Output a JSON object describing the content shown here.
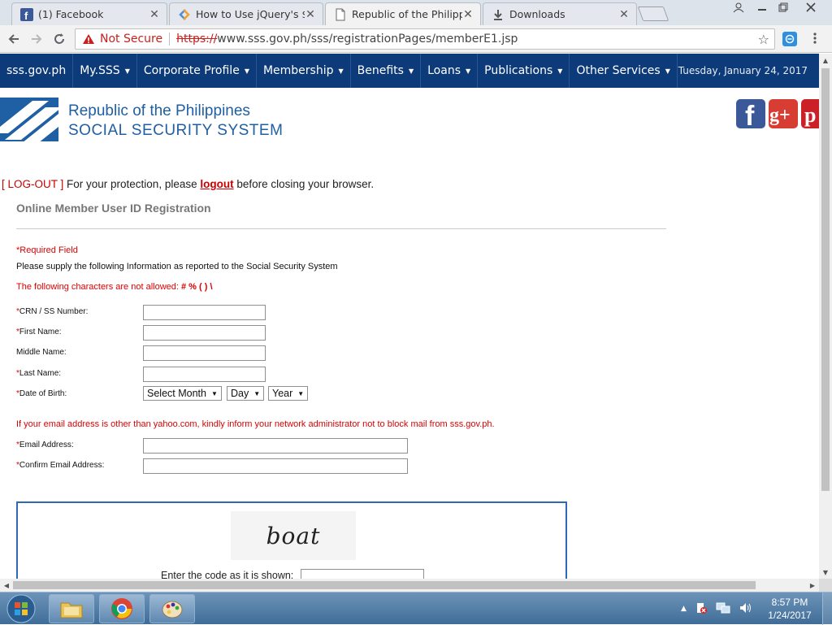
{
  "browser": {
    "tabs": [
      {
        "title": "(1) Facebook",
        "icon": "facebook-icon",
        "active": false
      },
      {
        "title": "How to Use jQuery's $.aj",
        "icon": "code-icon",
        "active": false
      },
      {
        "title": "Republic of the Philippin",
        "icon": "page-icon",
        "active": true
      },
      {
        "title": "Downloads",
        "icon": "download-icon",
        "active": false
      }
    ],
    "close_glyph": "✕",
    "security_label": "Not Secure",
    "url_scheme": "https://",
    "url_rest": "www.sss.gov.ph/sss/registrationPages/memberE1.jsp"
  },
  "sitenav": {
    "items": [
      {
        "label": "sss.gov.ph",
        "caret": false
      },
      {
        "label": "My.SSS",
        "caret": true
      },
      {
        "label": "Corporate Profile",
        "caret": true
      },
      {
        "label": "Membership",
        "caret": true
      },
      {
        "label": "Benefits",
        "caret": true
      },
      {
        "label": "Loans",
        "caret": true
      },
      {
        "label": "Publications",
        "caret": true
      },
      {
        "label": "Other Services",
        "caret": true
      }
    ],
    "date": "Tuesday, January 24, 2017"
  },
  "header": {
    "line1": "Republic of the Philippines",
    "line2": "SOCIAL SECURITY SYSTEM"
  },
  "notice": {
    "logout_tag": "[ LOG-OUT ]",
    "prefix": " For your protection, please ",
    "link": "logout",
    "suffix": " before closing your browser."
  },
  "form": {
    "title": "Online Member User ID Registration",
    "required_note": "*Required Field",
    "supply_note": "Please supply the following Information as reported to the Social Security System",
    "chars_note": "The following characters are not allowed: ",
    "chars_list": "# % ( ) \\",
    "fields": {
      "crn": {
        "label": "CRN / SS Number:",
        "required": true,
        "value": ""
      },
      "first": {
        "label": "First Name:",
        "required": true,
        "value": ""
      },
      "middle": {
        "label": "Middle Name:",
        "required": false,
        "value": ""
      },
      "last": {
        "label": "Last Name:",
        "required": true,
        "value": ""
      },
      "dob": {
        "label": "Date of Birth:",
        "required": true
      }
    },
    "dob_selects": {
      "month": "Select Month",
      "day": "Day",
      "year": "Year"
    },
    "email_note": "If your email address is other than yahoo.com, kindly inform your network administrator not to block mail from sss.gov.ph.",
    "email": {
      "label": "Email Address:",
      "value": ""
    },
    "confirm_email": {
      "label": "Confirm Email Address:",
      "value": ""
    },
    "captcha": {
      "text": "boat",
      "label": "Enter the code as it is shown:",
      "value": ""
    }
  },
  "taskbar": {
    "time": "8:57 PM",
    "date": "1/24/2017"
  },
  "colors": {
    "nav_bg": "#0d3a78",
    "brand_blue": "#1f5fa3",
    "required_red": "#dd0000"
  }
}
